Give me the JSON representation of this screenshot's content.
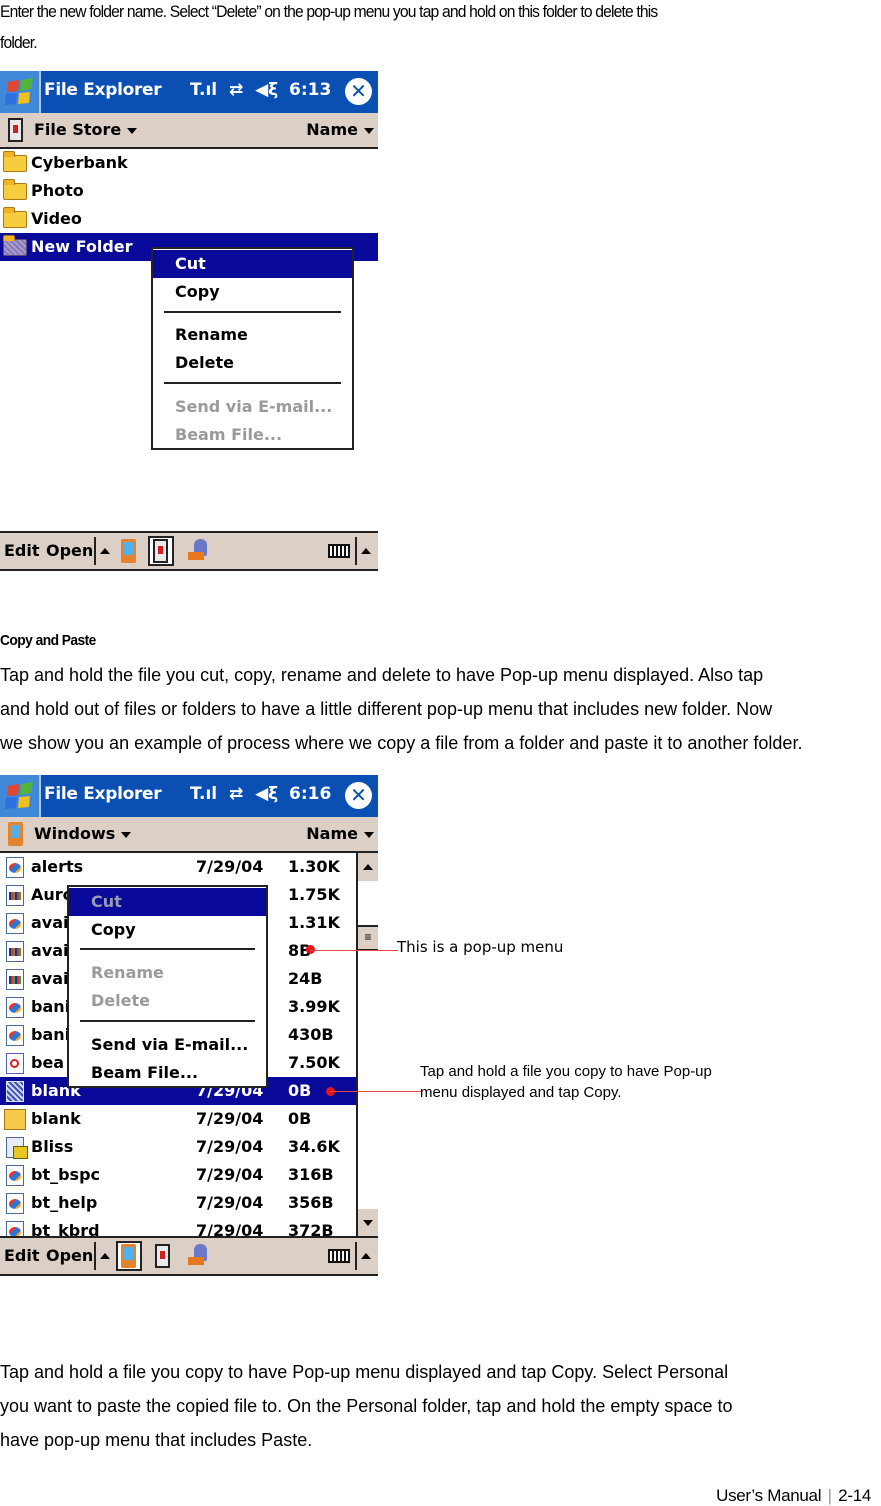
{
  "intro": {
    "line1": "Enter the new folder name. Select “Delete” on the pop-up menu you tap and hold on this folder to delete this",
    "line2": "folder."
  },
  "screenshot1": {
    "app_title": "File Explorer",
    "status_icons": {
      "signal": "signal-icon",
      "connectivity": "connectivity-icon",
      "volume": "volume-icon"
    },
    "time": "6:13",
    "close_icon": "close-icon",
    "location": "File Store",
    "sort_by": "Name",
    "items": [
      {
        "name": "Cyberbank",
        "icon": "folder-icon"
      },
      {
        "name": "Photo",
        "icon": "folder-icon"
      },
      {
        "name": "Video",
        "icon": "folder-icon"
      },
      {
        "name": "New Folder",
        "icon": "new-folder-icon",
        "selected": true
      }
    ],
    "popup_menu": [
      {
        "label": "Cut",
        "highlighted": true,
        "disabled": false
      },
      {
        "label": "Copy",
        "highlighted": false,
        "disabled": false
      },
      {
        "separator": true
      },
      {
        "label": "Rename",
        "highlighted": false,
        "disabled": false
      },
      {
        "label": "Delete",
        "highlighted": false,
        "disabled": false
      },
      {
        "separator": true
      },
      {
        "label": "Send via E-mail...",
        "highlighted": false,
        "disabled": true
      },
      {
        "label": "Beam File...",
        "highlighted": false,
        "disabled": true
      }
    ],
    "command_bar": {
      "edit": "Edit",
      "open": "Open",
      "selected_tool": "storage-card"
    }
  },
  "section": {
    "heading": "Copy and Paste",
    "para_lines": [
      "Tap and hold the file you cut, copy, rename and delete to have Pop-up menu displayed. Also tap",
      "and hold out of files or folders to have a little different pop-up menu that includes new folder. Now",
      "we show you an example of process where we copy a file from a folder and paste it to another folder."
    ]
  },
  "screenshot2": {
    "app_title": "File Explorer",
    "time": "6:16",
    "location": "Windows",
    "sort_by": "Name",
    "files": [
      {
        "name": "alerts",
        "date": "7/29/04",
        "size": "1.30K",
        "icon": "media-file-icon"
      },
      {
        "name": "Aurc",
        "date": "",
        "size": "1.75K",
        "icon": "sound-file-icon"
      },
      {
        "name": "avai",
        "date": "",
        "size": "1.31K",
        "icon": "media-file-icon"
      },
      {
        "name": "avai",
        "date": "",
        "size": "8B",
        "icon": "sound-file-icon"
      },
      {
        "name": "avai",
        "date": "",
        "size": "24B",
        "icon": "sound-file-icon"
      },
      {
        "name": "bani",
        "date": "",
        "size": "3.99K",
        "icon": "media-file-icon"
      },
      {
        "name": "bani",
        "date": "",
        "size": "430B",
        "icon": "media-file-icon"
      },
      {
        "name": "bea",
        "date": "",
        "size": "7.50K",
        "icon": "beam-file-icon"
      },
      {
        "name": "blank",
        "date": "7/29/04",
        "size": "0B",
        "icon": "selected-file-icon",
        "selected": true
      },
      {
        "name": "blank",
        "date": "7/29/04",
        "size": "0B",
        "icon": "blank-folder-icon"
      },
      {
        "name": "Bliss",
        "date": "7/29/04",
        "size": "34.6K",
        "icon": "bliss-file-icon"
      },
      {
        "name": "bt_bspc",
        "date": "7/29/04",
        "size": "316B",
        "icon": "media-file-icon"
      },
      {
        "name": "bt_help",
        "date": "7/29/04",
        "size": "356B",
        "icon": "media-file-icon"
      },
      {
        "name": "bt_kbrd",
        "date": "7/29/04",
        "size": "372B",
        "icon": "media-file-icon"
      }
    ],
    "popup_menu": [
      {
        "label": "Cut",
        "highlighted": true,
        "disabled": true
      },
      {
        "label": "Copy",
        "highlighted": false,
        "disabled": false
      },
      {
        "separator": true
      },
      {
        "label": "Rename",
        "highlighted": false,
        "disabled": true
      },
      {
        "label": "Delete",
        "highlighted": false,
        "disabled": true
      },
      {
        "separator": true
      },
      {
        "label": "Send via E-mail...",
        "highlighted": false,
        "disabled": false
      },
      {
        "label": "Beam File...",
        "highlighted": false,
        "disabled": false
      }
    ],
    "command_bar": {
      "edit": "Edit",
      "open": "Open",
      "selected_tool": "device"
    },
    "callouts": {
      "popup": "This is a pop-up menu",
      "copy_line1": "Tap and hold a file you copy to have Pop-up",
      "copy_line2": "menu displayed and tap Copy."
    }
  },
  "closing": {
    "lines": [
      "Tap and hold a file you copy to have Pop-up menu displayed and tap Copy. Select Personal",
      "you want to paste the copied file to. On the Personal folder, tap and hold the empty space to",
      "have pop-up menu that includes Paste."
    ]
  },
  "footer": {
    "label": "User’s Manual",
    "divider": "|",
    "page": "2-14"
  },
  "colors": {
    "title_bar": "#0c4fb3",
    "selection": "#0a0a9a",
    "chrome": "#dccfc5",
    "callout": "#e61616"
  }
}
